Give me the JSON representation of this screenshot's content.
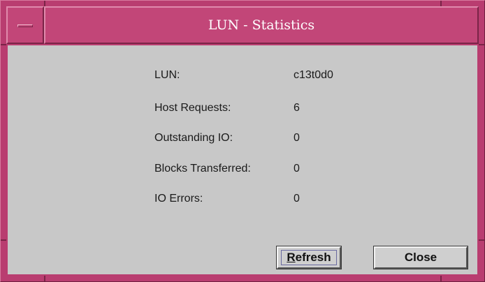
{
  "window": {
    "title": "LUN - Statistics",
    "menu_icon": "window-menu-icon"
  },
  "fields": [
    {
      "label": "LUN:",
      "value": "c13t0d0"
    },
    {
      "label": "Host Requests:",
      "value": "6"
    },
    {
      "label": "Outstanding IO:",
      "value": "0"
    },
    {
      "label": "Blocks Transferred:",
      "value": "0"
    },
    {
      "label": "IO Errors:",
      "value": "0"
    }
  ],
  "buttons": {
    "refresh_mnemonic": "R",
    "refresh_rest": "efresh",
    "close_label": "Close"
  },
  "colors": {
    "frame": "#b93d70",
    "titlebar": "#c24678",
    "title_text": "#ffffff",
    "client_bg": "#c8c8c8"
  }
}
